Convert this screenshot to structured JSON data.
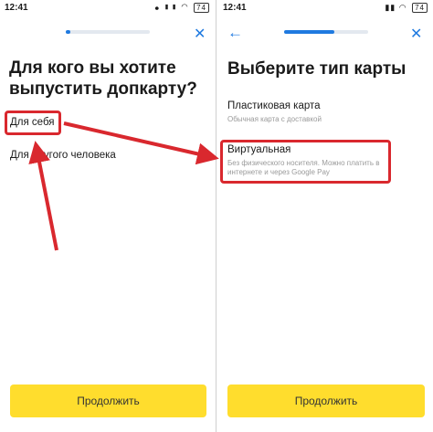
{
  "left": {
    "status": {
      "time": "12:41",
      "icons": "⦁ ▮▮ ◠",
      "battery": "74"
    },
    "title": "Для кого вы хотите выпустить допкарту?",
    "options": [
      "Для себя",
      "Для другого человека"
    ],
    "continue_label": "Продолжить",
    "progress": 0.05
  },
  "right": {
    "status": {
      "time": "12:41",
      "icons": "▮▮ ◠",
      "battery": "74"
    },
    "title": "Выберите тип карты",
    "options": [
      {
        "label": "Пластиковая карта",
        "sub": "Обычная карта с доставкой"
      },
      {
        "label": "Виртуальная",
        "sub": "Без физического носителя. Можно платить в интернете и через Google Pay"
      }
    ],
    "continue_label": "Продолжить",
    "progress": 0.6
  },
  "colors": {
    "accent": "#1f7ae0",
    "highlight": "#d9282e",
    "button": "#ffdd2d"
  }
}
